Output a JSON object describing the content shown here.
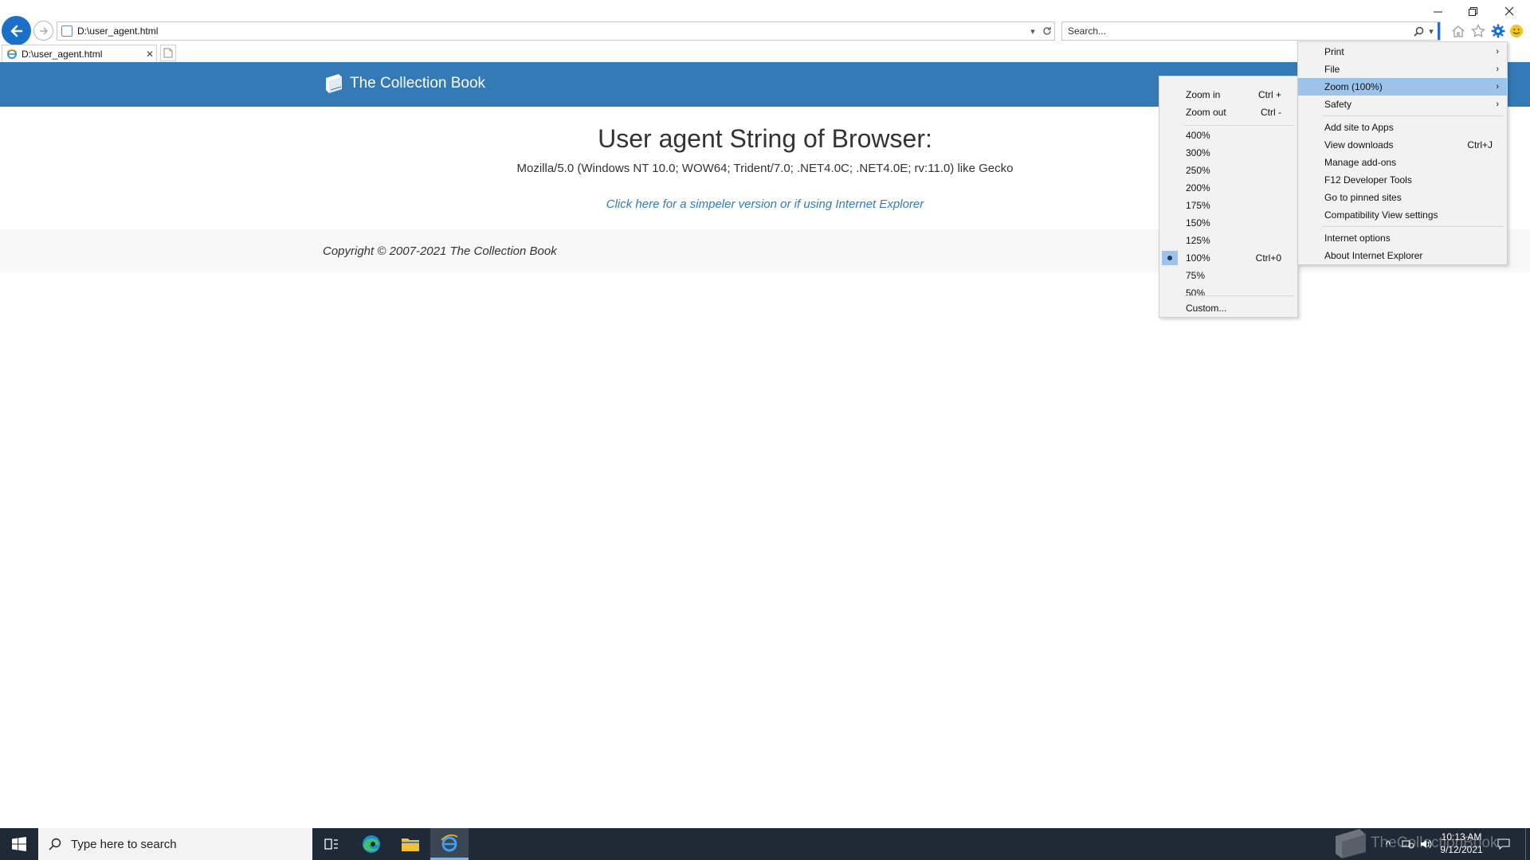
{
  "browser": {
    "address_url": "D:\\user_agent.html",
    "search_placeholder": "Search...",
    "tab_title": "D:\\user_agent.html"
  },
  "page": {
    "brand": "The Collection Book",
    "headline": "User agent String of Browser:",
    "user_agent": "Mozilla/5.0 (Windows NT 10.0; WOW64; Trident/7.0; .NET4.0C; .NET4.0E; rv:11.0) like Gecko",
    "simple_link": "Click here for a simpeler version or if using Internet Explorer",
    "copyright": "Copyright © 2007-2021 The Collection Book"
  },
  "tools_menu": {
    "print": "Print",
    "file": "File",
    "zoom": "Zoom (100%)",
    "safety": "Safety",
    "add_site": "Add site to Apps",
    "view_downloads": "View downloads",
    "view_downloads_shortcut": "Ctrl+J",
    "manage_addons": "Manage add-ons",
    "dev_tools": "F12 Developer Tools",
    "pinned_sites": "Go to pinned sites",
    "compat_view": "Compatibility View settings",
    "internet_options": "Internet options",
    "about_ie": "About Internet Explorer"
  },
  "zoom_menu": {
    "zoom_in": "Zoom in",
    "zoom_in_shortcut": "Ctrl +",
    "zoom_out": "Zoom out",
    "zoom_out_shortcut": "Ctrl -",
    "levels": [
      "400%",
      "300%",
      "250%",
      "200%",
      "175%",
      "150%",
      "125%",
      "100%",
      "75%",
      "50%"
    ],
    "selected_shortcut": "Ctrl+0",
    "custom": "Custom..."
  },
  "taskbar": {
    "search_placeholder": "Type here to search",
    "time": "10:13 AM",
    "date": "9/12/2021",
    "watermark": "TheCollectionBook"
  },
  "colors": {
    "header_blue": "#337ab7",
    "menu_highlight": "#9dc3ea",
    "taskbar": "#1f2a36"
  }
}
